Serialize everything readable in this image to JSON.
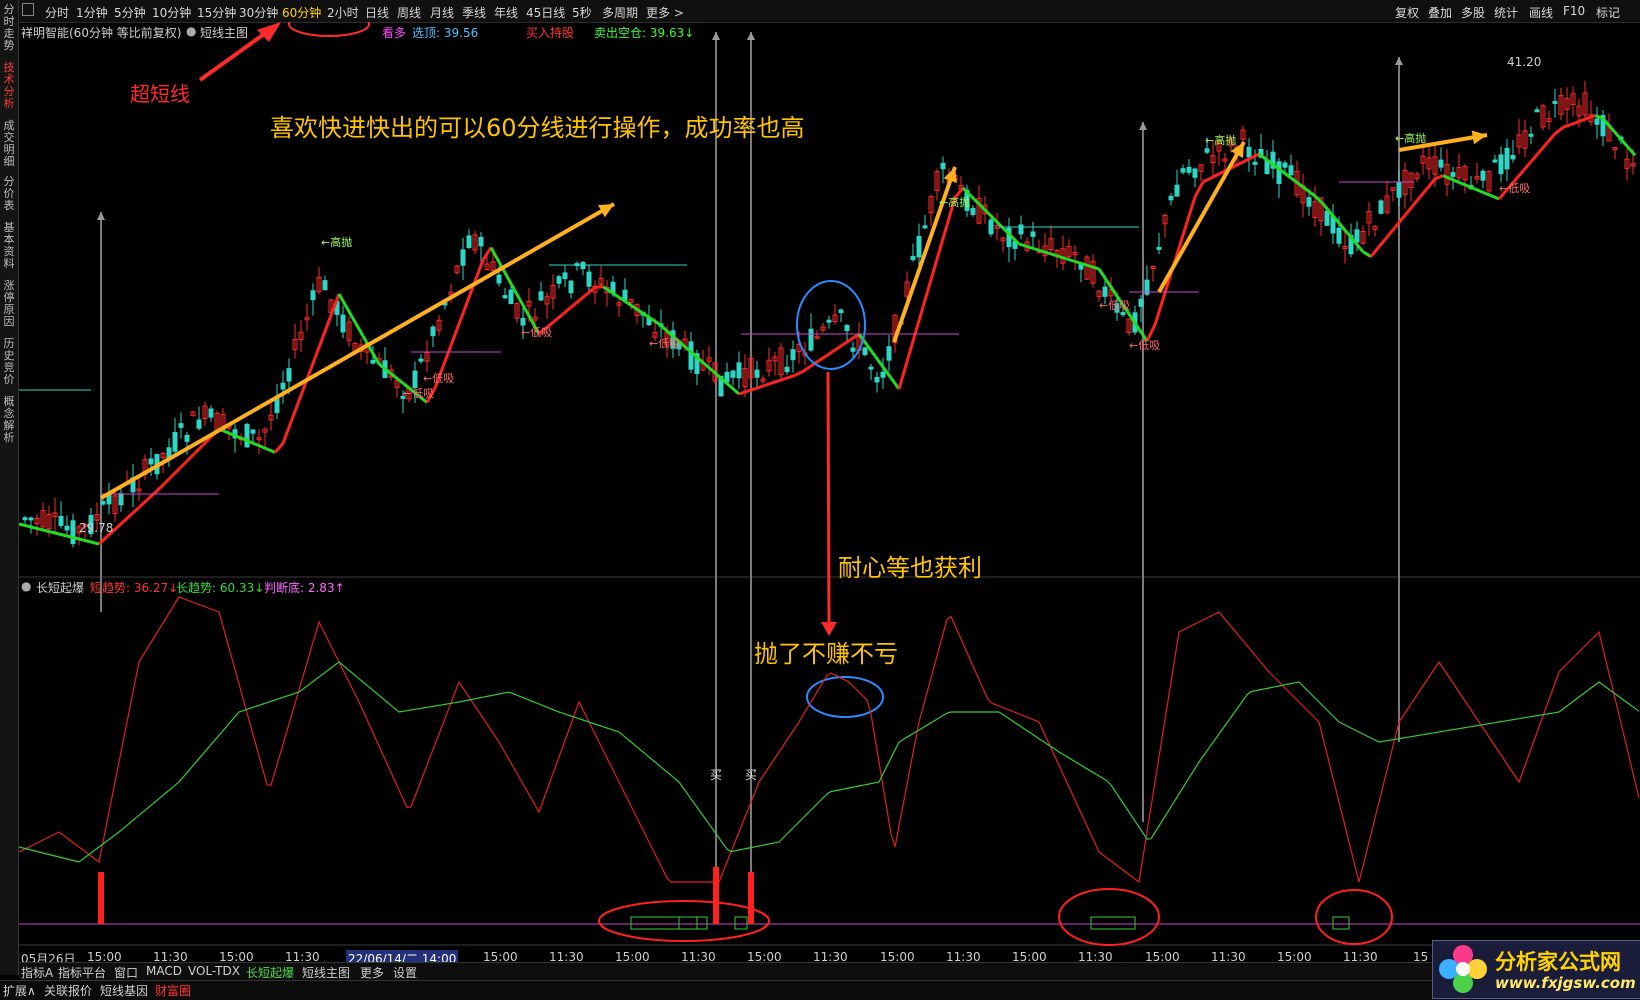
{
  "sidebar_tabs": [
    "分时走势",
    "技术分析",
    "成交明细",
    "分价表",
    "基本资料",
    "涨停原因",
    "历史竞价",
    "概念解析"
  ],
  "timeframes": [
    "分时",
    "1分钟",
    "5分钟",
    "10分钟",
    "15分钟",
    "30分钟",
    "60分钟",
    "2小时",
    "日线",
    "周线",
    "月线",
    "季线",
    "年线",
    "45日线",
    "5秒",
    "多周期",
    "更多 >"
  ],
  "active_timeframe": "60分钟",
  "toolbar_right": [
    "复权",
    "叠加",
    "多股",
    "统计",
    "画线",
    "F10",
    "标记"
  ],
  "main_chart": {
    "title": "祥明智能(60分钟 等比前复权)",
    "indicator_name": "短线主图",
    "tags": [
      {
        "text": "看多",
        "color": "#ff44ff"
      },
      {
        "text": "选顶: 39.56",
        "color": "#4fc3ff"
      },
      {
        "text": "买入持股",
        "color": "#ff3333"
      },
      {
        "text": "卖出空仓: 39.63↓",
        "color": "#33ff33"
      }
    ],
    "price_high_label": "41.20",
    "price_low_label": "29.78",
    "signal_labels": [
      "高抛",
      "低吸",
      "低吸",
      "低吸",
      "低吸",
      "高抛",
      "高抛",
      "低吸",
      "低吸",
      "低吸",
      "高抛"
    ]
  },
  "sub_chart": {
    "name": "长短起爆",
    "values": [
      {
        "text": "短趋势: 36.27↓",
        "color": "#ff3333"
      },
      {
        "text": "长趋势: 60.33↓",
        "color": "#33dd33"
      },
      {
        "text": "判断底: 2.83↑",
        "color": "#ff66ff"
      }
    ],
    "buy_labels": [
      "买",
      "买"
    ]
  },
  "x_axis": [
    "05月26日",
    "15:00",
    "11:30",
    "15:00",
    "11:30",
    "22/06/14/二 14:00",
    "15:00",
    "11:30",
    "15:00",
    "11:30",
    "15:00",
    "11:30",
    "15:00",
    "11:30",
    "15:00",
    "11:30",
    "15:00",
    "11:30",
    "15:00",
    "11:30",
    "15"
  ],
  "highlighted_x_label": "22/06/14/二 14:00",
  "bottom_tabs": [
    "指标A",
    "指标平台",
    "窗口",
    "MACD",
    "VOL-TDX",
    "长短起爆",
    "短线主图",
    "更多",
    "设置"
  ],
  "active_bottom_tab": "长短起爆",
  "status_tabs": [
    "扩展∧",
    "关联报价",
    "短线基因",
    "财富圈"
  ],
  "annotations": {
    "super_short": "超短线",
    "fast_trade": "喜欢快进快出的可以60分线进行操作，成功率也高",
    "patience": "耐心等也获利",
    "no_loss": "抛了不赚不亏"
  },
  "watermark": {
    "title": "分析家公式网",
    "url": "www.fxjgsw.com"
  },
  "colors": {
    "up": "#ff2a2a",
    "down": "#2ed6c6",
    "ma_green": "#22dd22",
    "ma_red": "#ff2222",
    "arrow": "#ffb020",
    "text_anno": "#ffc400",
    "annotation_red": "#ff2a2a",
    "circle_blue": "#2a8cff"
  }
}
